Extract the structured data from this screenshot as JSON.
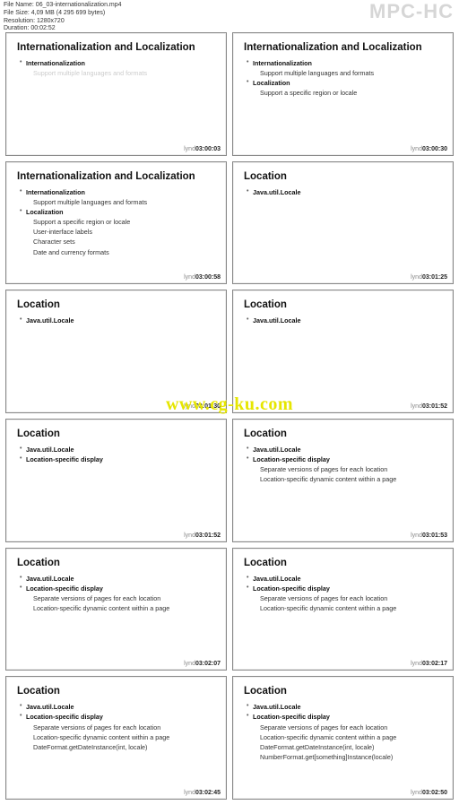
{
  "meta": {
    "file_name_label": "File Name: ",
    "file_name": "06_03-internationalization.mp4",
    "file_size_label": "File Size: ",
    "file_size": "4,09 MB (4 295 699 bytes)",
    "resolution_label": "Resolution: ",
    "resolution": "1280x720",
    "duration_label": "Duration: ",
    "duration": "00:02:52"
  },
  "app_title": "MPC-HC",
  "watermark": "www.cg-ku.com",
  "brand_prefix": "lynd",
  "slides": [
    {
      "title": "Internationalization and Localization",
      "timestamp": "03:00:03",
      "bullets": [
        {
          "text": "Internationalization",
          "type": "main"
        },
        {
          "text": "Support multiple languages and formats",
          "type": "sub faded"
        }
      ]
    },
    {
      "title": "Internationalization and Localization",
      "timestamp": "03:00:30",
      "bullets": [
        {
          "text": "Internationalization",
          "type": "main"
        },
        {
          "text": "Support multiple languages and formats",
          "type": "sub"
        },
        {
          "text": "Localization",
          "type": "main"
        },
        {
          "text": "Support a specific region or locale",
          "type": "sub"
        }
      ]
    },
    {
      "title": "Internationalization and Localization",
      "timestamp": "03:00:58",
      "bullets": [
        {
          "text": "Internationalization",
          "type": "main"
        },
        {
          "text": "Support multiple languages and formats",
          "type": "sub"
        },
        {
          "text": "Localization",
          "type": "main"
        },
        {
          "text": "Support a specific region or locale",
          "type": "sub"
        },
        {
          "text": "User-interface labels",
          "type": "sub"
        },
        {
          "text": "Character sets",
          "type": "sub"
        },
        {
          "text": "Date and currency formats",
          "type": "sub"
        }
      ]
    },
    {
      "title": "Location",
      "timestamp": "03:01:25",
      "bullets": [
        {
          "text": "Java.util.Locale",
          "type": "main"
        }
      ]
    },
    {
      "title": "Location",
      "timestamp": "03:01:30",
      "bullets": [
        {
          "text": "Java.util.Locale",
          "type": "main"
        }
      ]
    },
    {
      "title": "Location",
      "timestamp": "03:01:52",
      "bullets": [
        {
          "text": "Java.util.Locale",
          "type": "main"
        }
      ]
    },
    {
      "title": "Location",
      "timestamp": "03:01:52",
      "bullets": [
        {
          "text": "Java.util.Locale",
          "type": "main"
        },
        {
          "text": "Location-specific display",
          "type": "main"
        }
      ]
    },
    {
      "title": "Location",
      "timestamp": "03:01:53",
      "bullets": [
        {
          "text": "Java.util.Locale",
          "type": "main"
        },
        {
          "text": "Location-specific display",
          "type": "main"
        },
        {
          "text": "Separate versions of pages for each location",
          "type": "sub"
        },
        {
          "text": "Location-specific dynamic content within a page",
          "type": "sub"
        }
      ]
    },
    {
      "title": "Location",
      "timestamp": "03:02:07",
      "bullets": [
        {
          "text": "Java.util.Locale",
          "type": "main"
        },
        {
          "text": "Location-specific display",
          "type": "main"
        },
        {
          "text": "Separate versions of pages for each location",
          "type": "sub"
        },
        {
          "text": "Location-specific dynamic content within a page",
          "type": "sub"
        }
      ]
    },
    {
      "title": "Location",
      "timestamp": "03:02:17",
      "bullets": [
        {
          "text": "Java.util.Locale",
          "type": "main"
        },
        {
          "text": "Location-specific display",
          "type": "main"
        },
        {
          "text": "Separate versions of pages for each location",
          "type": "sub"
        },
        {
          "text": "Location-specific dynamic content within a page",
          "type": "sub"
        }
      ]
    },
    {
      "title": "Location",
      "timestamp": "03:02:45",
      "bullets": [
        {
          "text": "Java.util.Locale",
          "type": "main"
        },
        {
          "text": "Location-specific display",
          "type": "main"
        },
        {
          "text": "Separate versions of pages for each location",
          "type": "sub"
        },
        {
          "text": "Location-specific dynamic content within a page",
          "type": "sub"
        },
        {
          "text": "DateFormat.getDateInstance(int, locale)",
          "type": "sub"
        }
      ]
    },
    {
      "title": "Location",
      "timestamp": "03:02:50",
      "bullets": [
        {
          "text": "Java.util.Locale",
          "type": "main"
        },
        {
          "text": "Location-specific display",
          "type": "main"
        },
        {
          "text": "Separate versions of pages for each location",
          "type": "sub"
        },
        {
          "text": "Location-specific dynamic content within a page",
          "type": "sub"
        },
        {
          "text": "DateFormat.getDateInstance(int, locale)",
          "type": "sub"
        },
        {
          "text": "NumberFormat.get[something]Instance(locale)",
          "type": "sub"
        }
      ]
    }
  ]
}
